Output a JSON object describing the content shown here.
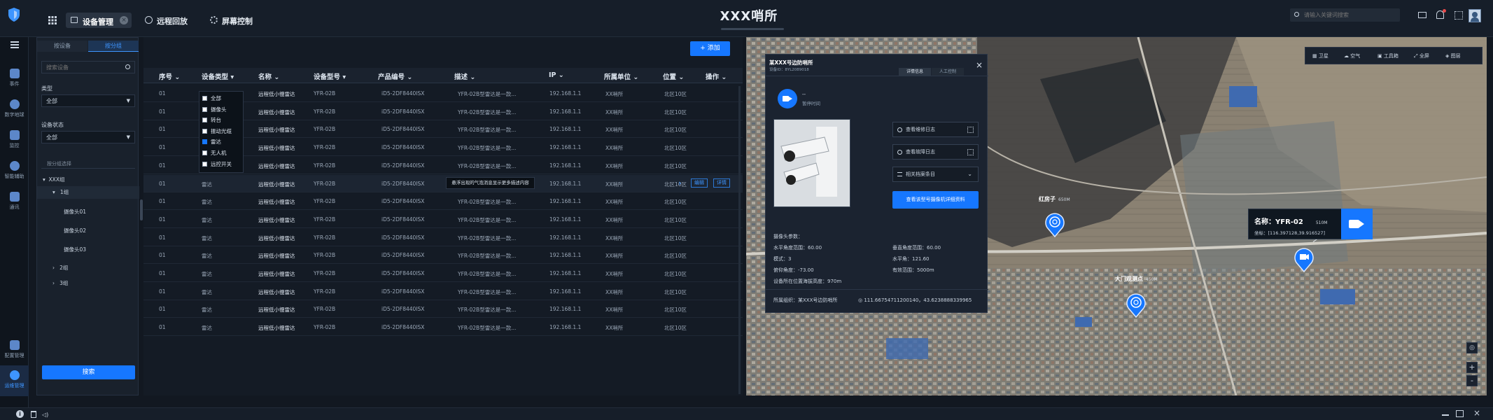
{
  "header": {
    "title": "XXX哨所",
    "tabs": [
      {
        "label": "设备管理",
        "active": true
      },
      {
        "label": "远程回放",
        "active": false
      },
      {
        "label": "屏幕控制",
        "active": false
      }
    ],
    "search_placeholder": "请输入关键词搜索"
  },
  "leftnav": {
    "items": [
      {
        "label": "事件"
      },
      {
        "label": "数字地球"
      },
      {
        "label": "监控"
      },
      {
        "label": "智能辅助"
      },
      {
        "label": "通讯"
      },
      {
        "label": "配置管理"
      },
      {
        "label": "运维管理"
      }
    ]
  },
  "filter": {
    "tabs": [
      "按设备",
      "按分组"
    ],
    "search_placeholder": "搜索设备",
    "type_label": "类型",
    "type_value": "全部",
    "status_label": "设备状态",
    "status_value": "全部",
    "group_label": "按分组选择",
    "tree": [
      "XXX组",
      "1组",
      "摄像头01",
      "摄像头02",
      "摄像头03",
      "2组",
      "3组"
    ],
    "search_button": "搜索"
  },
  "table": {
    "add_button": "+ 添加",
    "columns": [
      "序号",
      "设备类型",
      "名称",
      "设备型号",
      "产品编号",
      "描述",
      "IP",
      "所属单位",
      "位置",
      "操作"
    ],
    "rows": [
      {
        "no": "01",
        "type": "",
        "name": "远程低小慢雷达",
        "model": "YFR-02B",
        "pid": "iD5-2DF8440ISX",
        "desc": "YFR-02B型雷达是一款...",
        "ip": "192.168.1.1",
        "unit": "XX哨所",
        "loc": "北区10区"
      },
      {
        "no": "01",
        "type": "",
        "name": "远程低小慢雷达",
        "model": "YFR-02B",
        "pid": "iD5-2DF8440ISX",
        "desc": "YFR-02B型雷达是一款...",
        "ip": "192.168.1.1",
        "unit": "XX哨所",
        "loc": "北区10区"
      },
      {
        "no": "01",
        "type": "",
        "name": "远程低小慢雷达",
        "model": "YFR-02B",
        "pid": "iD5-2DF8440ISX",
        "desc": "YFR-02B型雷达是一款...",
        "ip": "192.168.1.1",
        "unit": "XX哨所",
        "loc": "北区10区"
      },
      {
        "no": "01",
        "type": "",
        "name": "远程低小慢雷达",
        "model": "YFR-02B",
        "pid": "iD5-2DF8440ISX",
        "desc": "YFR-02B型雷达是一款...",
        "ip": "192.168.1.1",
        "unit": "XX哨所",
        "loc": "北区10区"
      },
      {
        "no": "01",
        "type": "雷达",
        "name": "远程低小慢雷达",
        "model": "YFR-02B",
        "pid": "iD5-2DF8440ISX",
        "desc": "YFR-02B型雷达是一款...",
        "ip": "192.168.1.1",
        "unit": "XX哨所",
        "loc": "北区10区"
      },
      {
        "no": "01",
        "type": "雷达",
        "name": "远程低小慢雷达",
        "model": "YFR-02B",
        "pid": "iD5-2DF8440ISX",
        "desc": "YFR-02B型雷达是一款...",
        "ip": "192.168.1.1",
        "unit": "XX哨所",
        "loc": "北区10区"
      },
      {
        "no": "01",
        "type": "雷达",
        "name": "远程低小慢雷达",
        "model": "YFR-02B",
        "pid": "iD5-2DF8440ISX",
        "desc": "YFR-02B型雷达是一款...",
        "ip": "192.168.1.1",
        "unit": "XX哨所",
        "loc": "北区10区"
      },
      {
        "no": "01",
        "type": "雷达",
        "name": "远程低小慢雷达",
        "model": "YFR-02B",
        "pid": "iD5-2DF8440ISX",
        "desc": "YFR-02B型雷达是一款...",
        "ip": "192.168.1.1",
        "unit": "XX哨所",
        "loc": "北区10区"
      },
      {
        "no": "01",
        "type": "雷达",
        "name": "远程低小慢雷达",
        "model": "YFR-02B",
        "pid": "iD5-2DF8440ISX",
        "desc": "YFR-02B型雷达是一款...",
        "ip": "192.168.1.1",
        "unit": "XX哨所",
        "loc": "北区10区"
      },
      {
        "no": "01",
        "type": "雷达",
        "name": "远程低小慢雷达",
        "model": "YFR-02B",
        "pid": "iD5-2DF8440ISX",
        "desc": "YFR-02B型雷达是一款...",
        "ip": "192.168.1.1",
        "unit": "XX哨所",
        "loc": "北区10区"
      },
      {
        "no": "01",
        "type": "雷达",
        "name": "远程低小慢雷达",
        "model": "YFR-02B",
        "pid": "iD5-2DF8440ISX",
        "desc": "YFR-02B型雷达是一款...",
        "ip": "192.168.1.1",
        "unit": "XX哨所",
        "loc": "北区10区"
      },
      {
        "no": "01",
        "type": "雷达",
        "name": "远程低小慢雷达",
        "model": "YFR-02B",
        "pid": "iD5-2DF8440ISX",
        "desc": "YFR-02B型雷达是一款...",
        "ip": "192.168.1.1",
        "unit": "XX哨所",
        "loc": "北区10区"
      },
      {
        "no": "01",
        "type": "雷达",
        "name": "远程低小慢雷达",
        "model": "YFR-02B",
        "pid": "iD5-2DF8440ISX",
        "desc": "YFR-02B型雷达是一款...",
        "ip": "192.168.1.1",
        "unit": "XX哨所",
        "loc": "北区10区"
      },
      {
        "no": "01",
        "type": "雷达",
        "name": "远程低小慢雷达",
        "model": "YFR-02B",
        "pid": "iD5-2DF8440ISX",
        "desc": "YFR-02B型雷达是一款...",
        "ip": "192.168.1.1",
        "unit": "XX哨所",
        "loc": "北区10区"
      }
    ],
    "row_actions": {
      "edit": "编辑",
      "detail": "详情"
    },
    "tooltip": "悬浮出现的气泡消息显示更多描述内容",
    "type_filter_options": [
      {
        "label": "全部",
        "checked": false
      },
      {
        "label": "摄像头",
        "checked": false
      },
      {
        "label": "转台",
        "checked": false
      },
      {
        "label": "振动光缆",
        "checked": false
      },
      {
        "label": "雷达",
        "checked": true
      },
      {
        "label": "无人机",
        "checked": false
      },
      {
        "label": "远控开关",
        "checked": false
      }
    ]
  },
  "popup": {
    "title": "某XXX号边防哨所",
    "subtitle": "设备ID：8YL2089018",
    "tabs": [
      "详情信息",
      "人工控制"
    ],
    "status_top": "--",
    "status_label": "暂停时间",
    "buttons": [
      "查看维修日志",
      "查看故障日志",
      "相关档案条目"
    ],
    "primary_button": "查看该型号摄像机详细资料",
    "params_title": "摄像头参数：",
    "params": [
      "水平角度范围：60.00",
      "垂直角度范围：60.00",
      "模式：3",
      "水平角：121.60",
      "俯仰角度：-73.00",
      "有效范围：5000m"
    ],
    "altitude": "设备所在位置海拔高度：970m",
    "org": "所属组织：某XXX号边防哨所",
    "coords": "111.66754711200140，43.6238888339965"
  },
  "map": {
    "tools": [
      "卫星",
      "空气",
      "工具箱",
      "全屏",
      "图层"
    ],
    "pins": [
      {
        "label": "红房子",
        "dist": "650M"
      },
      {
        "label": "大门观测点",
        "dist": "450M"
      }
    ],
    "info": {
      "name": "名称：YFR-02",
      "dist": "510M",
      "coord": "坐标：[116.397128,39.916527]"
    },
    "zoom_in": "+",
    "zoom_out": "-"
  },
  "colors": {
    "accent": "#1677ff",
    "bg": "#121821",
    "panel": "#19212c"
  }
}
